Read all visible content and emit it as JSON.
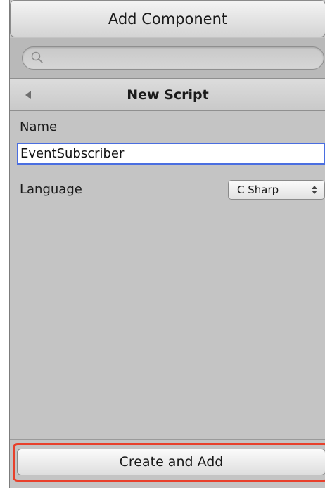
{
  "header": {
    "title": "Add Component"
  },
  "search": {
    "value": "",
    "placeholder": ""
  },
  "titlebar": {
    "title": "New Script"
  },
  "form": {
    "name_label": "Name",
    "name_value": "EventSubscriber",
    "language_label": "Language",
    "language_value": "C Sharp"
  },
  "footer": {
    "create_label": "Create and Add"
  },
  "colors": {
    "focus_ring": "#4a6ee0",
    "annotation_highlight": "#e8402b",
    "panel_background": "#c4c4c4"
  },
  "icons": {
    "search": "search-icon",
    "back": "back-arrow-icon",
    "select": "updown-chevron-icon"
  }
}
